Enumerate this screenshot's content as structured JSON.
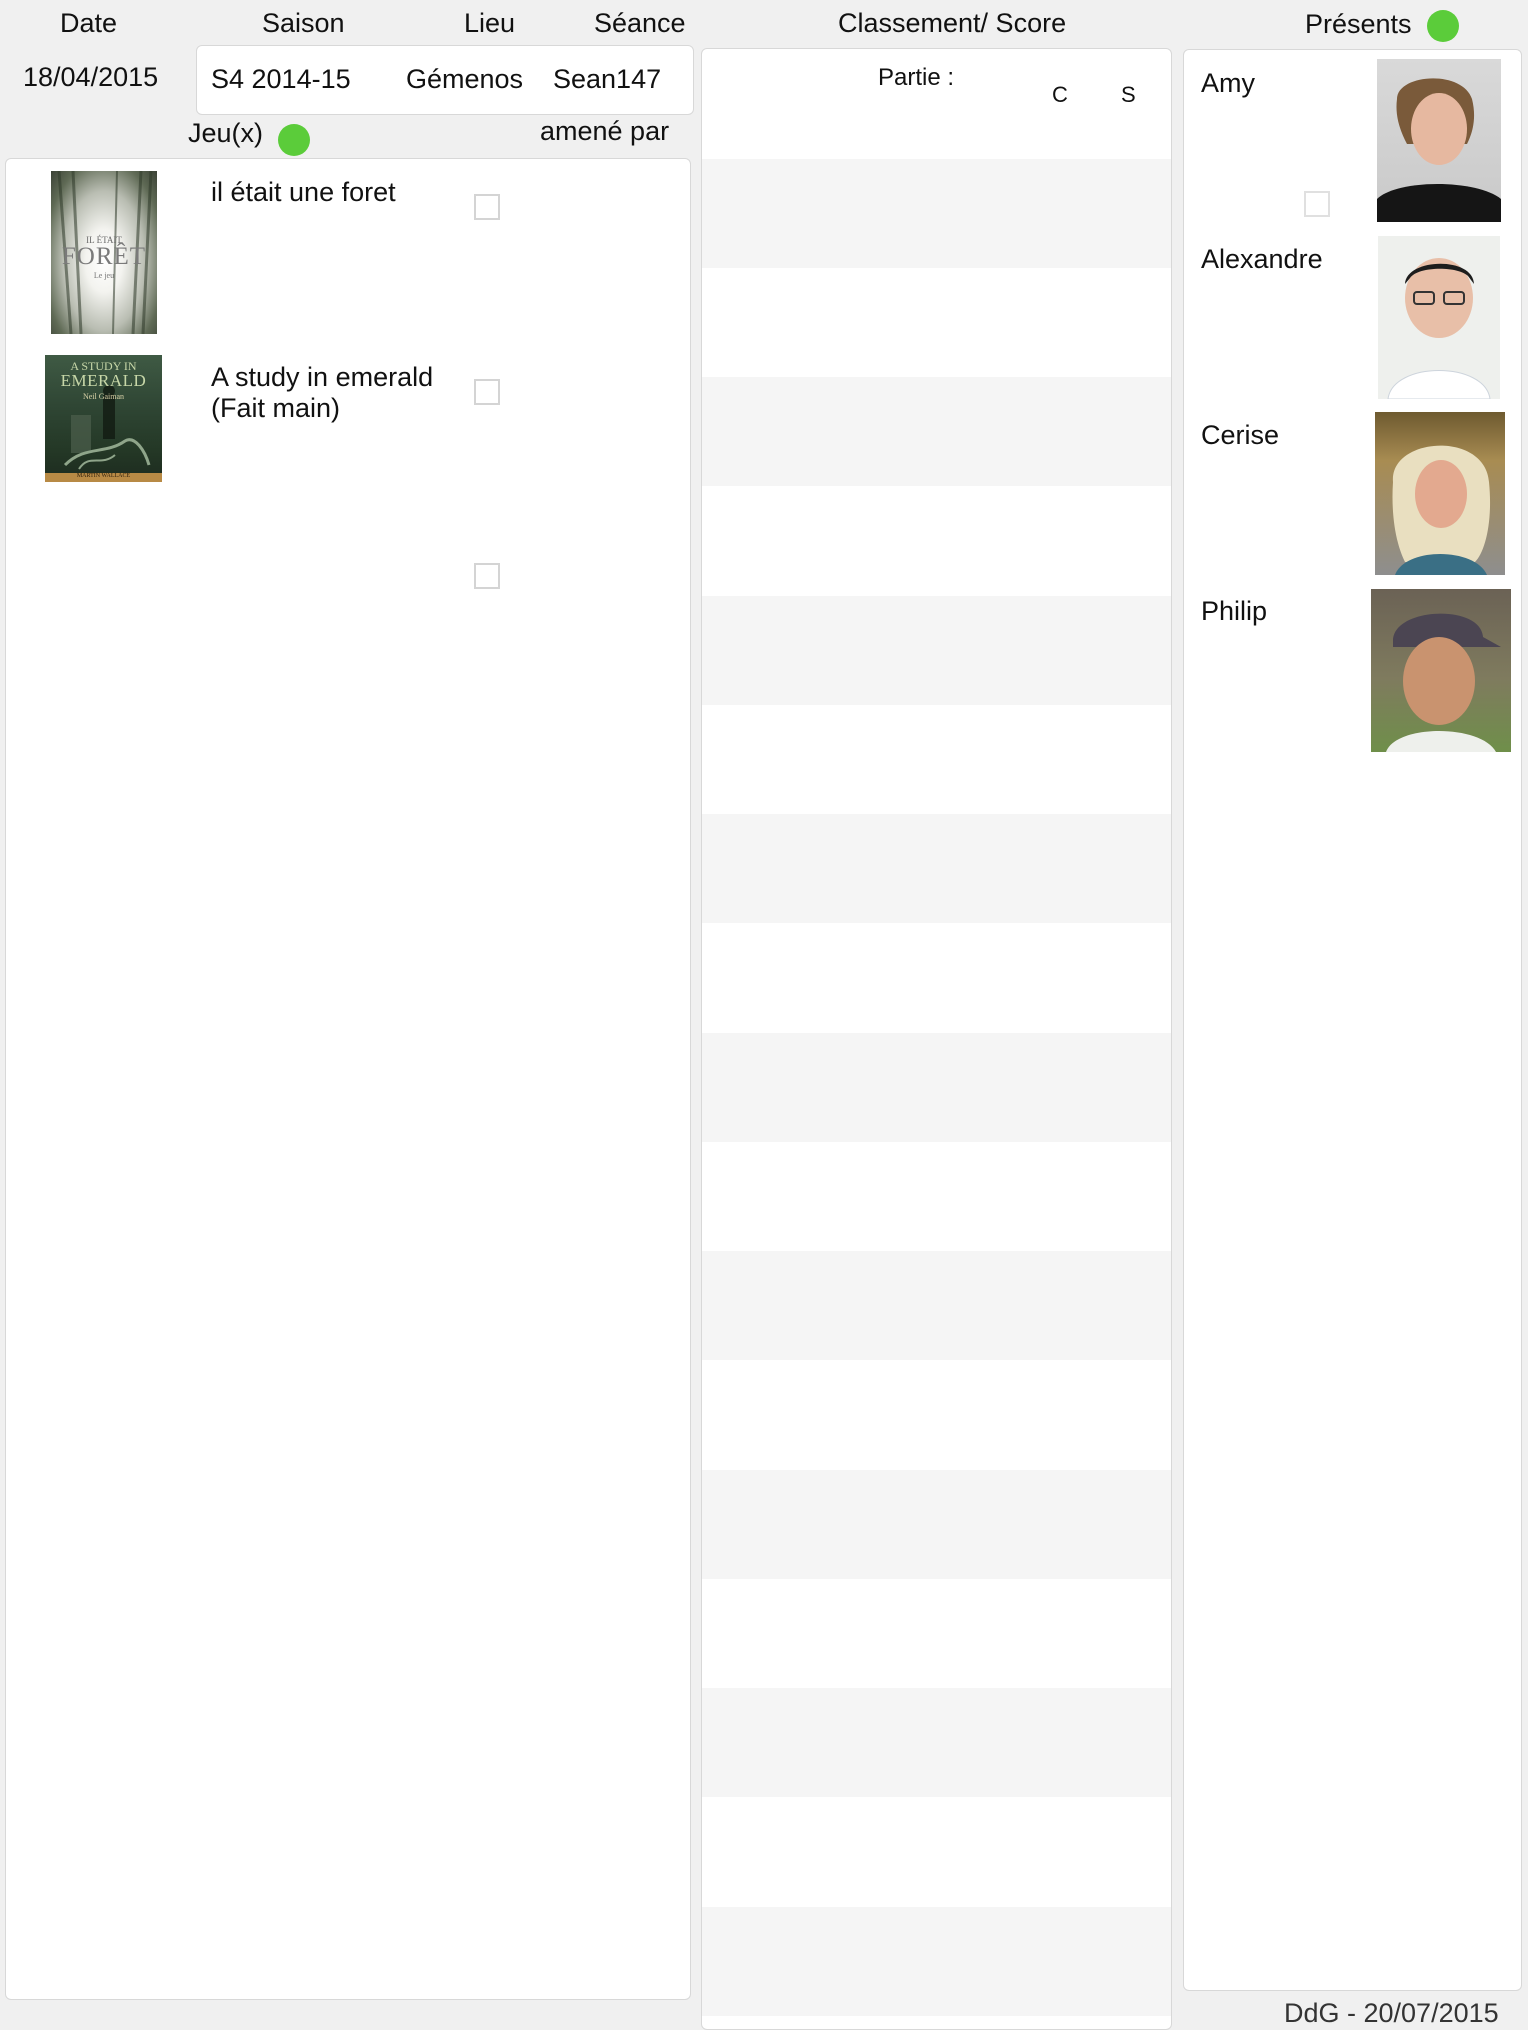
{
  "headers": {
    "date": "Date",
    "saison": "Saison",
    "lieu": "Lieu",
    "seance": "Séance",
    "classement": "Classement/ Score",
    "presents": "Présents"
  },
  "session": {
    "date": "18/04/2015",
    "saison": "S4 2014-15",
    "lieu": "Gémenos",
    "seance": "Sean147"
  },
  "games_header": {
    "jeux": "Jeu(x)",
    "amene_par": "amené par"
  },
  "games": [
    {
      "title": "il était une foret",
      "cover_icon": "book-cover-icon",
      "checked": false
    },
    {
      "title": "A study in emerald (Fait main)",
      "cover_icon": "book-cover-icon",
      "checked": false
    },
    {
      "title": "",
      "checked": false
    }
  ],
  "covers": {
    "foret": {
      "line1": "IL ÉTAIT",
      "line2": "FORÊT",
      "line3": "Le jeu"
    },
    "emerald": {
      "line1": "A STUDY IN",
      "line2": "EMERALD",
      "line3": "Neil Gaiman",
      "line4": "MARTIN WALLACE"
    }
  },
  "score": {
    "partie_label": "Partie :",
    "col_c": "C",
    "col_s": "S"
  },
  "players": [
    {
      "name": "Amy",
      "checked": false
    },
    {
      "name": "Alexandre"
    },
    {
      "name": "Cerise"
    },
    {
      "name": "Philip"
    }
  ],
  "footer": {
    "text": "DdG - 20/07/2015"
  },
  "colors": {
    "status_dot": "#5bcc3a",
    "background": "#f0f0f0",
    "stripe": "#f5f5f5"
  }
}
